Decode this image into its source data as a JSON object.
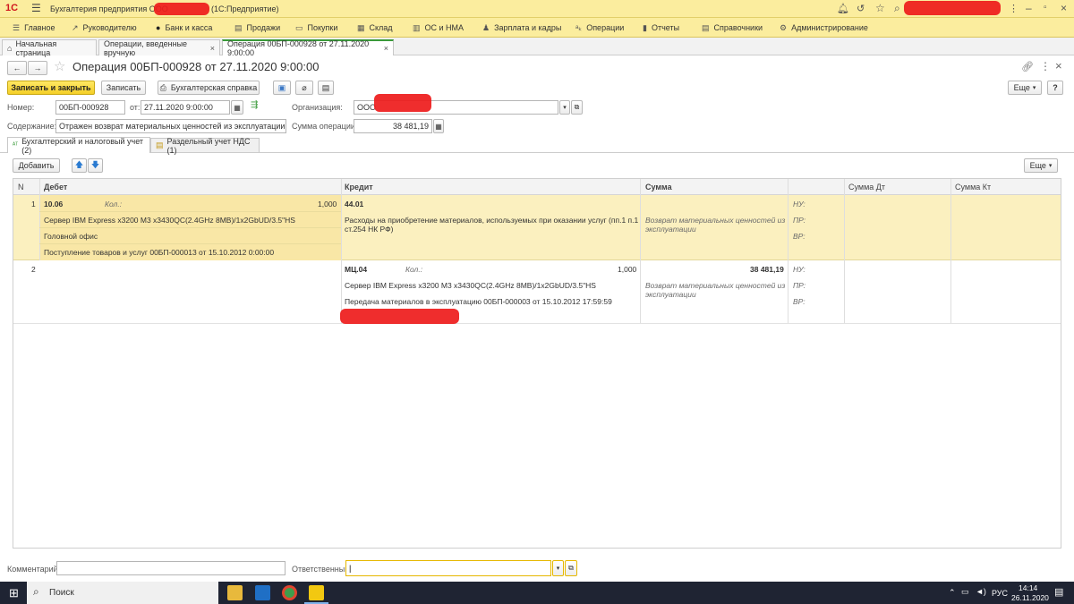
{
  "window": {
    "title_prefix": "Бухгалтерия предприятия ООО",
    "title_suffix": "(1С:Предприятие)",
    "logo": "1С"
  },
  "menu": [
    {
      "icon": "hamburger-icon",
      "label": "Главное"
    },
    {
      "icon": "trend-icon",
      "label": "Руководителю"
    },
    {
      "icon": "bank-icon",
      "label": "Банк и касса"
    },
    {
      "icon": "cart-icon",
      "label": "Продажи"
    },
    {
      "icon": "basket-icon",
      "label": "Покупки"
    },
    {
      "icon": "warehouse-icon",
      "label": "Склад"
    },
    {
      "icon": "assets-icon",
      "label": "ОС и НМА"
    },
    {
      "icon": "person-icon",
      "label": "Зарплата и кадры"
    },
    {
      "icon": "operations-icon",
      "label": "Операции"
    },
    {
      "icon": "chart-icon",
      "label": "Отчеты"
    },
    {
      "icon": "book-icon",
      "label": "Справочники"
    },
    {
      "icon": "gear-icon",
      "label": "Администрирование"
    }
  ],
  "tabs": [
    {
      "label": "Начальная страница"
    },
    {
      "label": "Операции, введенные вручную"
    },
    {
      "label": "Операция 00БП-000928 от 27.11.2020 9:00:00"
    }
  ],
  "doc": {
    "title": "Операция 00БП-000928 от 27.11.2020 9:00:00",
    "buttons": {
      "save_close": "Записать и закрыть",
      "save": "Записать",
      "report": "Бухгалтерская справка",
      "more": "Еще",
      "help": "?"
    },
    "fields": {
      "number_label": "Номер:",
      "number_value": "00БП-000928",
      "date_label": "от:",
      "date_value": "27.11.2020  9:00:00",
      "org_label": "Организация:",
      "org_value": "ООО",
      "content_label": "Содержание:",
      "content_value": "Отражен возврат материальных ценностей из эксплуатации для их",
      "sum_label": "Сумма операции:",
      "sum_value": "38 481,19"
    }
  },
  "subtabs": [
    {
      "label": "Бухгалтерский и налоговый учет (2)"
    },
    {
      "label": "Раздельный учет НДС (1)"
    }
  ],
  "grid": {
    "add_label": "Добавить",
    "more_label": "Еще",
    "columns": [
      "N",
      "Дебет",
      "Кредит",
      "Сумма",
      "",
      "Сумма Дт",
      "Сумма Кт"
    ],
    "rows": [
      {
        "n": "1",
        "debit_account": "10.06",
        "qty_label": "Кол.:",
        "qty_value": "1,000",
        "debit_line2": "Сервер IBM Express x3200 M3 x3430QC(2.4GHz 8MB)/1x2GbUD/3.5\"HS",
        "debit_line3": "Головной офис",
        "debit_line4": "Поступление товаров и услуг 00БП-000013 от 15.10.2012 0:00:00",
        "credit_account": "44.01",
        "credit_line2": "Расходы на приобретение материалов, используемых при оказании услуг (пп.1 п.1",
        "credit_line3": "ст.254 НК РФ)",
        "sum": "",
        "comment1": "Возврат материальных ценностей из",
        "comment2": "эксплуатации",
        "nu": "НУ:",
        "pr": "ПР:",
        "vr": "ВР:"
      },
      {
        "n": "2",
        "credit_account": "МЦ.04",
        "qty_label": "Кол.:",
        "qty_value": "1,000",
        "sum": "38 481,19",
        "credit_line2": "Сервер IBM Express x3200 M3 x3430QC(2.4GHz 8MB)/1x2GbUD/3.5\"HS",
        "credit_line3": "Передача материалов в эксплуатацию 00БП-000003 от 15.10.2012 17:59:59",
        "comment1": "Возврат материальных ценностей из",
        "comment2": "эксплуатации",
        "nu": "НУ:",
        "pr": "ПР:",
        "vr": "ВР:"
      }
    ]
  },
  "footer": {
    "comment_label": "Комментарий:",
    "responsible_label": "Ответственный:"
  },
  "taskbar": {
    "search_label": "Поиск",
    "lang": "РУС",
    "time": "14:14",
    "date": "26.11.2020"
  },
  "colors": {
    "brand_yellow": "#fbed9e",
    "selected_row": "#fbf0bf",
    "primary_button": "#f4cf27",
    "redaction": "#ee1b1b"
  }
}
